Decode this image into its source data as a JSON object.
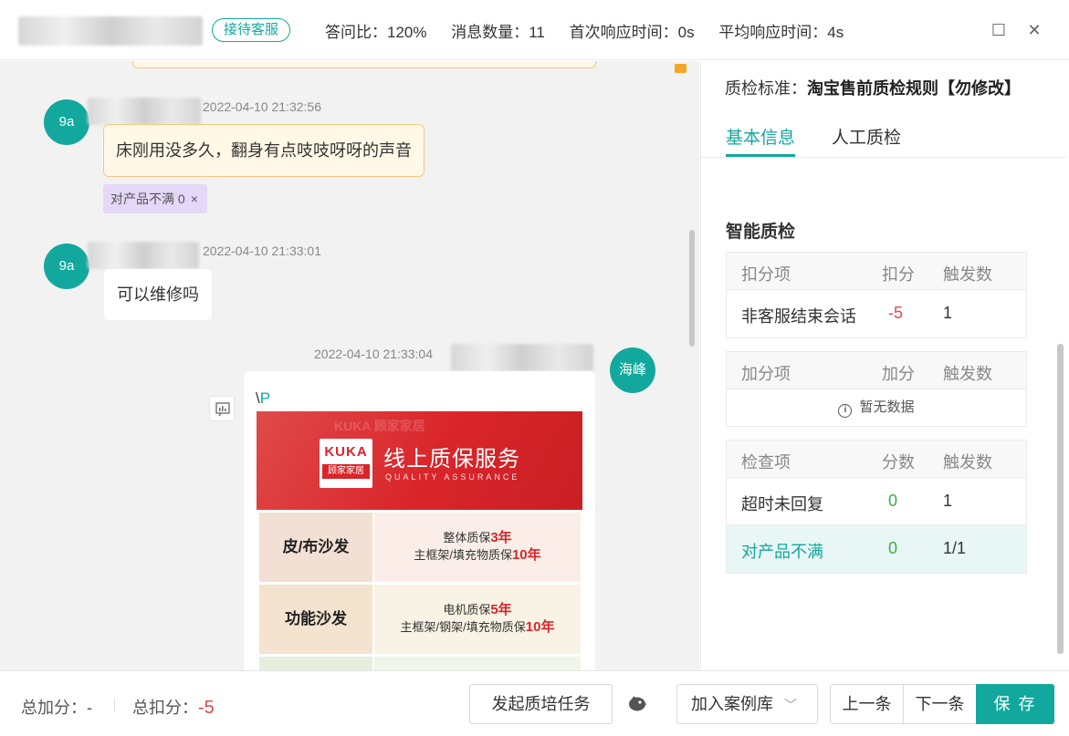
{
  "header": {
    "status_badge": "接待客服",
    "stats": [
      "答问比：120%",
      "消息数量：11",
      "首次响应时间：0s",
      "平均响应时间：4s"
    ],
    "maximize_symbol": "☐",
    "close_symbol": "✕"
  },
  "chat": {
    "messages": [
      {
        "avatar": "9a",
        "timestamp": "2022-04-10 21:32:56",
        "text": "床刚用没多久，翻身有点吱吱呀呀的声音",
        "tag": "对产品不满 0",
        "tag_close": "×"
      },
      {
        "avatar": "9a",
        "timestamp": "2022-04-10 21:33:01",
        "text": "可以维修吗"
      },
      {
        "avatar": "海峰",
        "timestamp": "2022-04-10 21:33:04",
        "text_prefix": "\\",
        "text_p": "P"
      }
    ],
    "promo": {
      "ghost_text": "KUKA 顾家家居",
      "logo_top": "KUKA",
      "logo_bottom": "顾家家居",
      "title": "线上质保服务",
      "subtitle": "QUALITY ASSURANCE",
      "rows": [
        {
          "category": "皮/布沙发",
          "line1_prefix": "整体质保",
          "line1_value": "3年",
          "line2_prefix": "主框架/填充物质保",
          "line2_value": "10年"
        },
        {
          "category": "功能沙发",
          "line1_prefix": "电机质保",
          "line1_value": "5年",
          "line2_prefix": "主框架/钢架/填充物质保",
          "line2_value": "10年"
        }
      ]
    }
  },
  "right_panel": {
    "standard_label": "质检标准：",
    "standard_value": "淘宝售前质检规则【勿修改】",
    "tabs": [
      "基本信息",
      "人工质检"
    ],
    "section_title": "智能质检",
    "deduct_table": {
      "headers": [
        "扣分项",
        "扣分",
        "触发数"
      ],
      "rows": [
        [
          "非客服结束会话",
          "-5",
          "1"
        ]
      ]
    },
    "add_table": {
      "headers": [
        "加分项",
        "加分",
        "触发数"
      ],
      "empty_text": "暂无数据",
      "empty_icon": "i"
    },
    "check_table": {
      "headers": [
        "检查项",
        "分数",
        "触发数"
      ],
      "rows": [
        [
          "超时未回复",
          "0",
          "1"
        ],
        [
          "对产品不满",
          "0",
          "1/1"
        ]
      ]
    }
  },
  "footer": {
    "total_add_label": "总加分：",
    "total_add_value": "-",
    "total_deduct_label": "总扣分：",
    "total_deduct_value": "-5",
    "training_button": "发起质培任务",
    "case_library_button": "加入案例库",
    "prev_button": "上一条",
    "next_button": "下一条",
    "save_button": "保 存"
  },
  "colors": {
    "primary": "#12a89d",
    "negative": "#e04a4a",
    "positive": "#3cae4b",
    "tag_bg": "#e4d7f7",
    "customer_bubble": "#fff8e6"
  }
}
